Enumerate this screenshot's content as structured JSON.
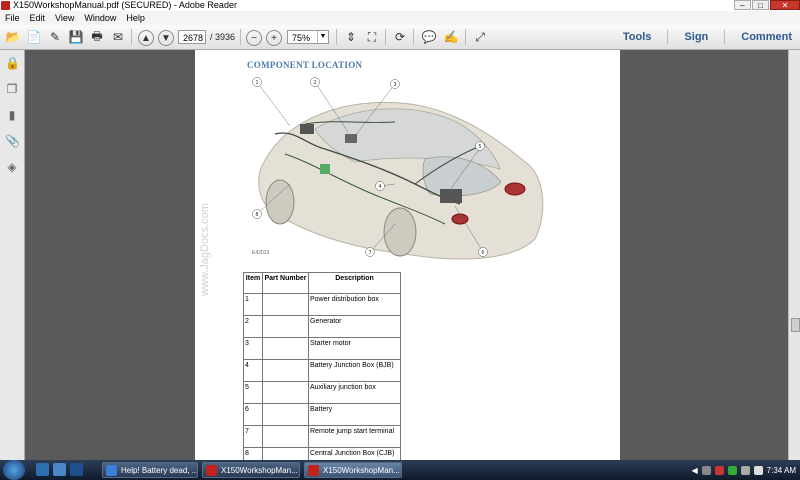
{
  "window": {
    "title": "X150WorkshopManual.pdf (SECURED) - Adobe Reader",
    "min": "–",
    "max": "□",
    "close": "✕"
  },
  "menu": [
    "File",
    "Edit",
    "View",
    "Window",
    "Help"
  ],
  "toolbar": {
    "page_current": "2678",
    "page_total": "/ 3936",
    "zoom": "75%",
    "tools": "Tools",
    "sign": "Sign",
    "comment": "Comment"
  },
  "document": {
    "section_title": "COMPONENT LOCATION",
    "watermark": "www.JagDocs.com",
    "figure_code": "E42013",
    "callouts": [
      "1",
      "2",
      "3",
      "4",
      "5",
      "6",
      "7",
      "8"
    ],
    "table": {
      "headers": [
        "Item",
        "Part Number",
        "Description"
      ],
      "rows": [
        {
          "item": "1",
          "part": "",
          "desc": "Power distribution box"
        },
        {
          "item": "2",
          "part": "",
          "desc": "Generator"
        },
        {
          "item": "3",
          "part": "",
          "desc": "Starter motor"
        },
        {
          "item": "4",
          "part": "",
          "desc": "Battery Junction Box (BJB)"
        },
        {
          "item": "5",
          "part": "",
          "desc": "Auxiliary junction box"
        },
        {
          "item": "6",
          "part": "",
          "desc": "Battery"
        },
        {
          "item": "7",
          "part": "",
          "desc": "Remote jump start terminal"
        },
        {
          "item": "8",
          "part": "",
          "desc": "Central Junction Box (CJB)"
        }
      ]
    }
  },
  "taskbar": {
    "items": [
      {
        "label": "Help! Battery dead, ...",
        "active": false,
        "color": "#3b7dd8"
      },
      {
        "label": "X150WorkshopMan...",
        "active": false,
        "color": "#c0221c"
      },
      {
        "label": "X150WorkshopMan...",
        "active": true,
        "color": "#c0221c"
      }
    ],
    "clock": "7:34 AM"
  },
  "colors": {
    "accent": "#2d5a8e",
    "section_title": "#4d7aa6"
  }
}
